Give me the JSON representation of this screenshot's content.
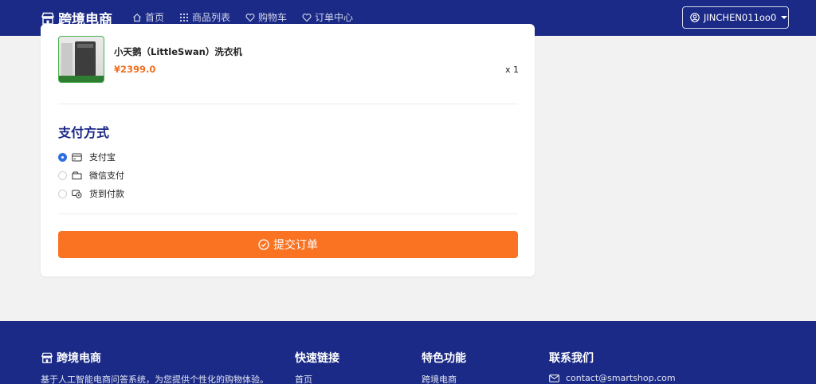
{
  "navbar": {
    "brand": "跨境电商",
    "links": [
      {
        "label": "首页",
        "icon": "home-icon"
      },
      {
        "label": "商品列表",
        "icon": "grid-icon"
      },
      {
        "label": "购物车",
        "icon": "heart-icon"
      },
      {
        "label": "订单中心",
        "icon": "heart-icon"
      }
    ],
    "user": "JINCHEN011oo0"
  },
  "order_item": {
    "name": "小天鹅（LittleSwan）洗衣机",
    "price": "¥2399.0",
    "quantity": "x 1"
  },
  "payment": {
    "title": "支付方式",
    "options": [
      {
        "label": "支付宝",
        "icon": "credit-card-icon",
        "selected": true
      },
      {
        "label": "微信支付",
        "icon": "wallet-icon",
        "selected": false
      },
      {
        "label": "货到付款",
        "icon": "cash-icon",
        "selected": false
      }
    ]
  },
  "submit": {
    "label": "提交订单"
  },
  "footer": {
    "brand": "跨境电商",
    "description": "基于人工智能电商问答系统，为您提供个性化的购物体验。",
    "columns": [
      {
        "title": "快速链接",
        "first_link": "首页"
      },
      {
        "title": "特色功能",
        "first_link": "跨境电商"
      },
      {
        "title": "联系我们",
        "first_link": "contact@smartshop.com"
      }
    ]
  },
  "colors": {
    "navy": "#1b2a86",
    "accent_orange": "#f97322",
    "price_orange": "#f07021",
    "radio_blue": "#2f6fde"
  }
}
